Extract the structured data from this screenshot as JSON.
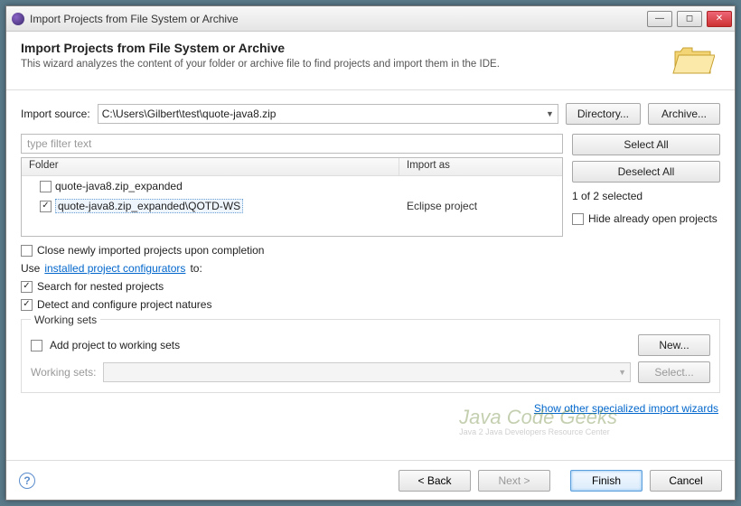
{
  "titlebar": {
    "title": "Import Projects from File System or Archive"
  },
  "header": {
    "heading": "Import Projects from File System or Archive",
    "description": "This wizard analyzes the content of your folder or archive file to find projects and import them in the IDE."
  },
  "source": {
    "label": "Import source:",
    "value": "C:\\Users\\Gilbert\\test\\quote-java8.zip",
    "directory_btn": "Directory...",
    "archive_btn": "Archive..."
  },
  "filter": {
    "placeholder": "type filter text"
  },
  "table": {
    "col_folder": "Folder",
    "col_import": "Import as",
    "rows": [
      {
        "checked": false,
        "folder": "quote-java8.zip_expanded",
        "import_as": ""
      },
      {
        "checked": true,
        "folder": "quote-java8.zip_expanded\\QOTD-WS",
        "import_as": "Eclipse project"
      }
    ]
  },
  "side": {
    "select_all": "Select All",
    "deselect_all": "Deselect All",
    "count": "1 of 2 selected",
    "hide_open": "Hide already open projects"
  },
  "options": {
    "close_on_complete": "Close newly imported projects upon completion",
    "use_prefix": "Use ",
    "use_link": "installed project configurators",
    "use_suffix": " to:",
    "search_nested": "Search for nested projects",
    "detect_natures": "Detect and configure project natures"
  },
  "working_sets": {
    "legend": "Working sets",
    "add": "Add project to working sets",
    "new_btn": "New...",
    "label": "Working sets:",
    "select_btn": "Select..."
  },
  "wizlink": "Show other specialized import wizards",
  "footer": {
    "back": "< Back",
    "next": "Next >",
    "finish": "Finish",
    "cancel": "Cancel"
  },
  "watermark": {
    "big": "Java Code Geeks",
    "small": "Java 2 Java Developers Resource Center"
  }
}
